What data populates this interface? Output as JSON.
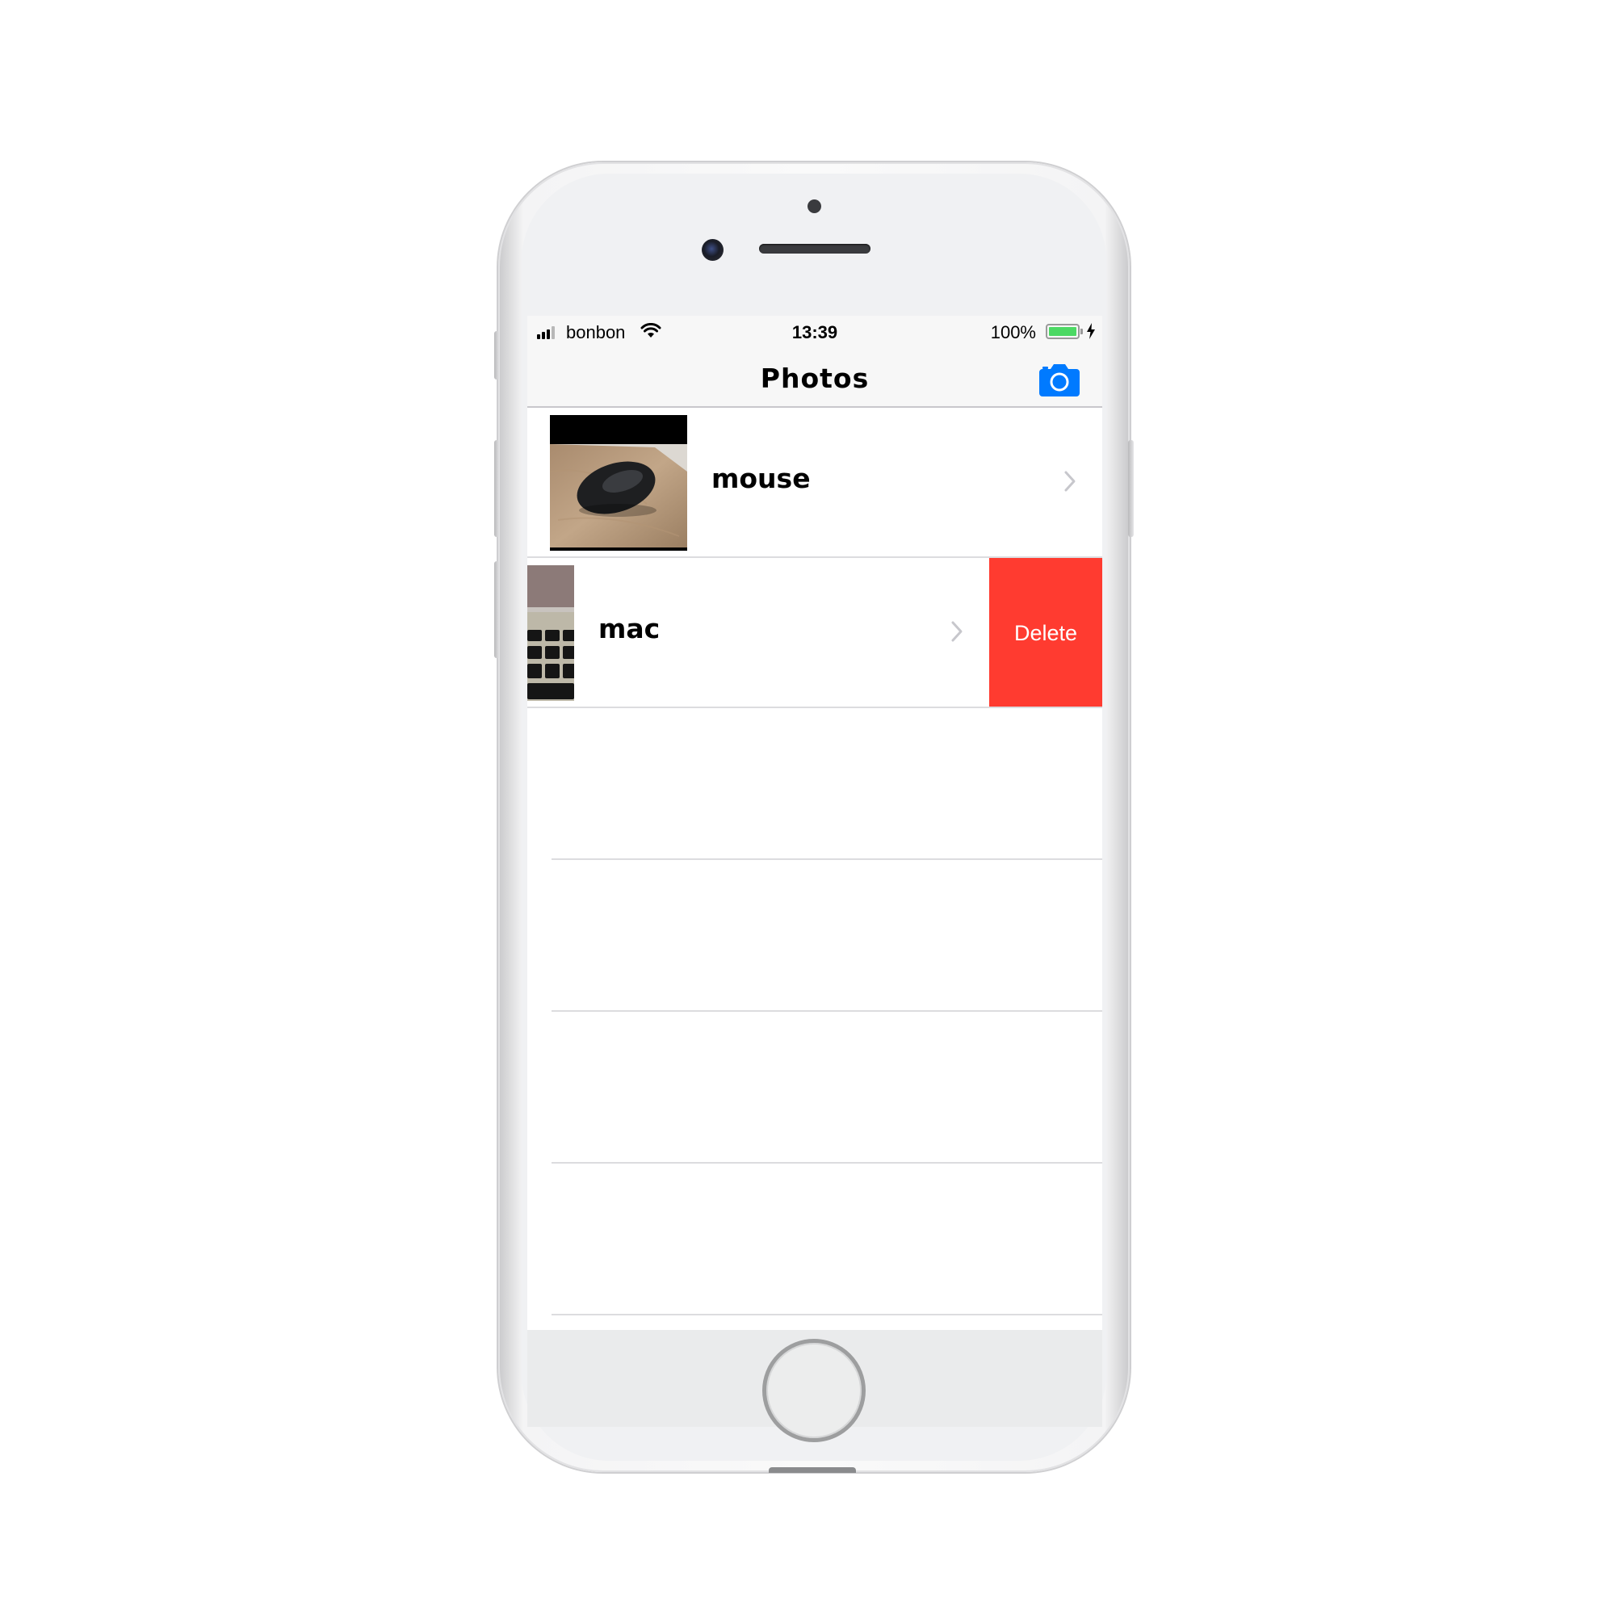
{
  "status_bar": {
    "carrier": "bonbon",
    "time": "13:39",
    "battery_percent": "100%",
    "battery_level": 1.0,
    "battery_color": "#4cd964",
    "signal_bars": 3,
    "icons": [
      "signal-icon",
      "wifi-icon",
      "battery-icon",
      "charging-bolt-icon"
    ]
  },
  "nav_bar": {
    "title": "Photos",
    "right_button_icon": "camera-icon",
    "accent_color": "#007aff"
  },
  "rows": [
    {
      "label": "mouse",
      "thumbnail": "photo of a black wireless mouse on a wooden desk",
      "swiped": false
    },
    {
      "label": "mac",
      "thumbnail": "photo of a laptop keyboard",
      "swiped": true,
      "action_label": "Delete",
      "action_color": "#ff3b30"
    }
  ],
  "empty_rows": 4
}
